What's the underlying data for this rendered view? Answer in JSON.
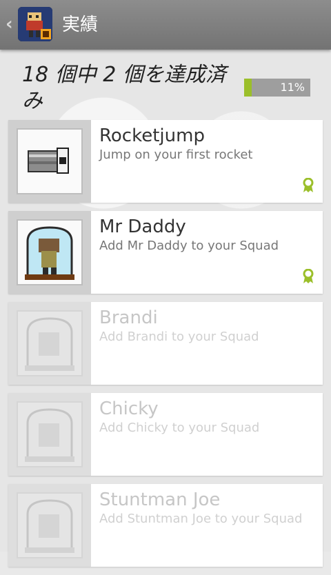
{
  "header": {
    "title": "実績",
    "back_icon": "chevron-left-icon",
    "app_icon": "app-hero-icon"
  },
  "summary": {
    "text": "18 個中 2 個を達成済み",
    "progress_label": "11%",
    "progress_value": 0.11,
    "accent": "#9bbf2a"
  },
  "achievements": [
    {
      "name": "Rocketjump",
      "description": "Jump on your first rocket",
      "unlocked": true,
      "icon": "rocket-icon"
    },
    {
      "name": "Mr Daddy",
      "description": "Add Mr Daddy to your Squad",
      "unlocked": true,
      "icon": "bell-jar-character-icon"
    },
    {
      "name": "Brandi",
      "description": "Add Brandi to your Squad",
      "unlocked": false,
      "icon": "bell-jar-character-icon"
    },
    {
      "name": "Chicky",
      "description": "Add Chicky to your Squad",
      "unlocked": false,
      "icon": "bell-jar-character-icon"
    },
    {
      "name": "Stuntman Joe",
      "description": "Add Stuntman Joe to your Squad",
      "unlocked": false,
      "icon": "bell-jar-character-icon"
    }
  ]
}
